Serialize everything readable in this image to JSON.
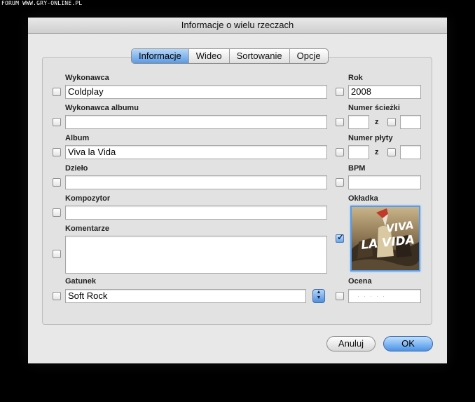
{
  "watermark": "FORUM WWW.GRY-ONLINE.PL",
  "window": {
    "title": "Informacje o wielu rzeczach"
  },
  "tabs": [
    {
      "label": "Informacje",
      "active": true
    },
    {
      "label": "Wideo",
      "active": false
    },
    {
      "label": "Sortowanie",
      "active": false
    },
    {
      "label": "Opcje",
      "active": false
    }
  ],
  "fields": {
    "artist": {
      "label": "Wykonawca",
      "value": "Coldplay"
    },
    "album_artist": {
      "label": "Wykonawca albumu",
      "value": ""
    },
    "album": {
      "label": "Album",
      "value": "Viva la Vida"
    },
    "work": {
      "label": "Dzieło",
      "value": ""
    },
    "composer": {
      "label": "Kompozytor",
      "value": ""
    },
    "comments": {
      "label": "Komentarze",
      "value": ""
    },
    "genre": {
      "label": "Gatunek",
      "value": "Soft Rock"
    },
    "year": {
      "label": "Rok",
      "value": "2008"
    },
    "track_number": {
      "label": "Numer ścieżki",
      "of_label": "z",
      "value": "",
      "total": ""
    },
    "disc_number": {
      "label": "Numer płyty",
      "of_label": "z",
      "value": "",
      "total": ""
    },
    "bpm": {
      "label": "BPM",
      "value": ""
    },
    "artwork": {
      "label": "Okładka",
      "artwork_checked": true
    },
    "rating": {
      "label": "Ocena",
      "value": 0
    }
  },
  "buttons": {
    "cancel": "Anuluj",
    "ok": "OK"
  },
  "colors": {
    "accent": "#5a9ae6",
    "window_bg": "#e8e8e8"
  }
}
